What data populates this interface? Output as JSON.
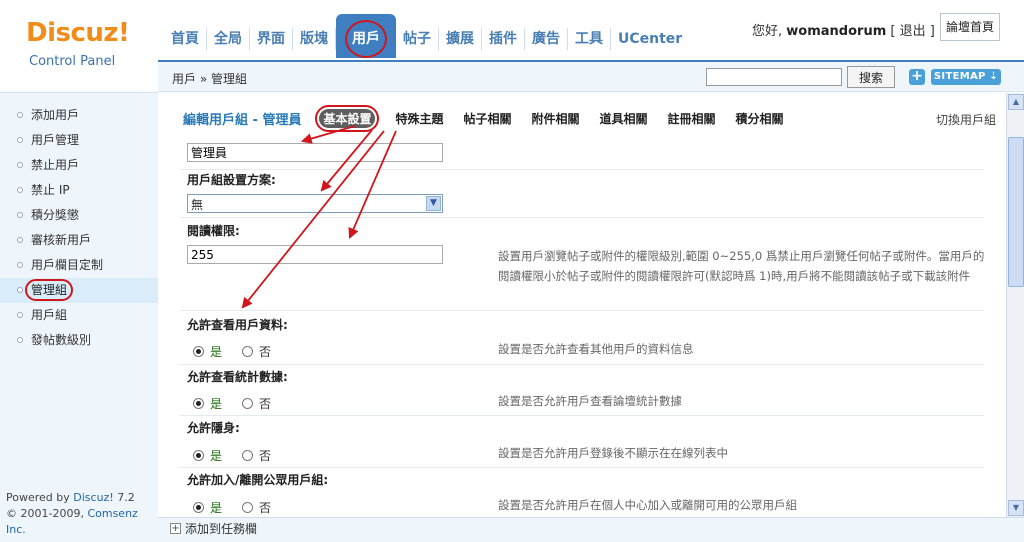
{
  "logo": {
    "brand": "Discuz!",
    "subtitle": "Control Panel"
  },
  "nav": {
    "tabs": [
      "首頁",
      "全局",
      "界面",
      "版塊",
      "用戶",
      "帖子",
      "擴展",
      "插件",
      "廣告",
      "工具",
      "UCenter"
    ],
    "active_tab": "用戶"
  },
  "user": {
    "greeting": "您好,",
    "name": "womandorum",
    "logout": "[ 退出 ]",
    "forum_home": "論壇首頁"
  },
  "breadcrumb": "用戶 » 管理組",
  "search": {
    "value": "",
    "button": "搜索"
  },
  "toolbar": {
    "plus": "+",
    "sitemap": "SITEMAP ⇣"
  },
  "sidebar": {
    "items": [
      {
        "label": "添加用戶"
      },
      {
        "label": "用戶管理"
      },
      {
        "label": "禁止用戶"
      },
      {
        "label": "禁止 IP"
      },
      {
        "label": "積分獎懲"
      },
      {
        "label": "審核新用戶"
      },
      {
        "label": "用戶欄目定制"
      },
      {
        "label": "管理組",
        "active": true
      },
      {
        "label": "用戶組"
      },
      {
        "label": "發帖數級別"
      }
    ],
    "footer": {
      "powered_prefix": "Powered by ",
      "product": "Discuz!",
      "version": " 7.2",
      "copyright": "© 2001-2009, ",
      "company": "Comsenz Inc."
    }
  },
  "edit_group": {
    "title": "編輯用戶組 - 管理員",
    "subtabs": [
      "基本設置",
      "特殊主題",
      "帖子相關",
      "附件相關",
      "道具相關",
      "註冊相關",
      "積分相關"
    ],
    "active_subtab": "基本設置",
    "switch_group": "切換用戶組",
    "group_name_value": "管理員",
    "scheme_label": "用戶組設置方案:",
    "scheme_value": "無",
    "read_perm_label": "閱讀權限:",
    "read_perm_value": "255",
    "read_perm_desc": "設置用戶瀏覽帖子或附件的權限級別,範圍 0~255,0 爲禁止用戶瀏覽任何帖子或附件。當用戶的閱讀權限小於帖子或附件的閱讀權限許可(默認時爲 1)時,用戶將不能閱讀該帖子或下載該附件",
    "yes": "是",
    "no": "否",
    "options": [
      {
        "label": "允許查看用戶資料:",
        "value": "yes",
        "desc": "設置是否允許查看其他用戶的資料信息"
      },
      {
        "label": "允許查看統計數據:",
        "value": "yes",
        "desc": "設置是否允許用戶查看論壇統計數據"
      },
      {
        "label": "允許隱身:",
        "value": "yes",
        "desc": "設置是否允許用戶登錄後不顯示在在線列表中"
      },
      {
        "label": "允許加入/離開公眾用戶組:",
        "value": "yes",
        "desc": "設置是否允許用戶在個人中心加入或離開可用的公眾用戶組"
      }
    ]
  },
  "taskbar": {
    "add_task": "添加到任務欄"
  },
  "colors": {
    "accent": "#3f7fc1",
    "brand_orange": "#f08c1a",
    "annotation_red": "#d0151b",
    "sidebar_bg": "#eef6fc"
  }
}
